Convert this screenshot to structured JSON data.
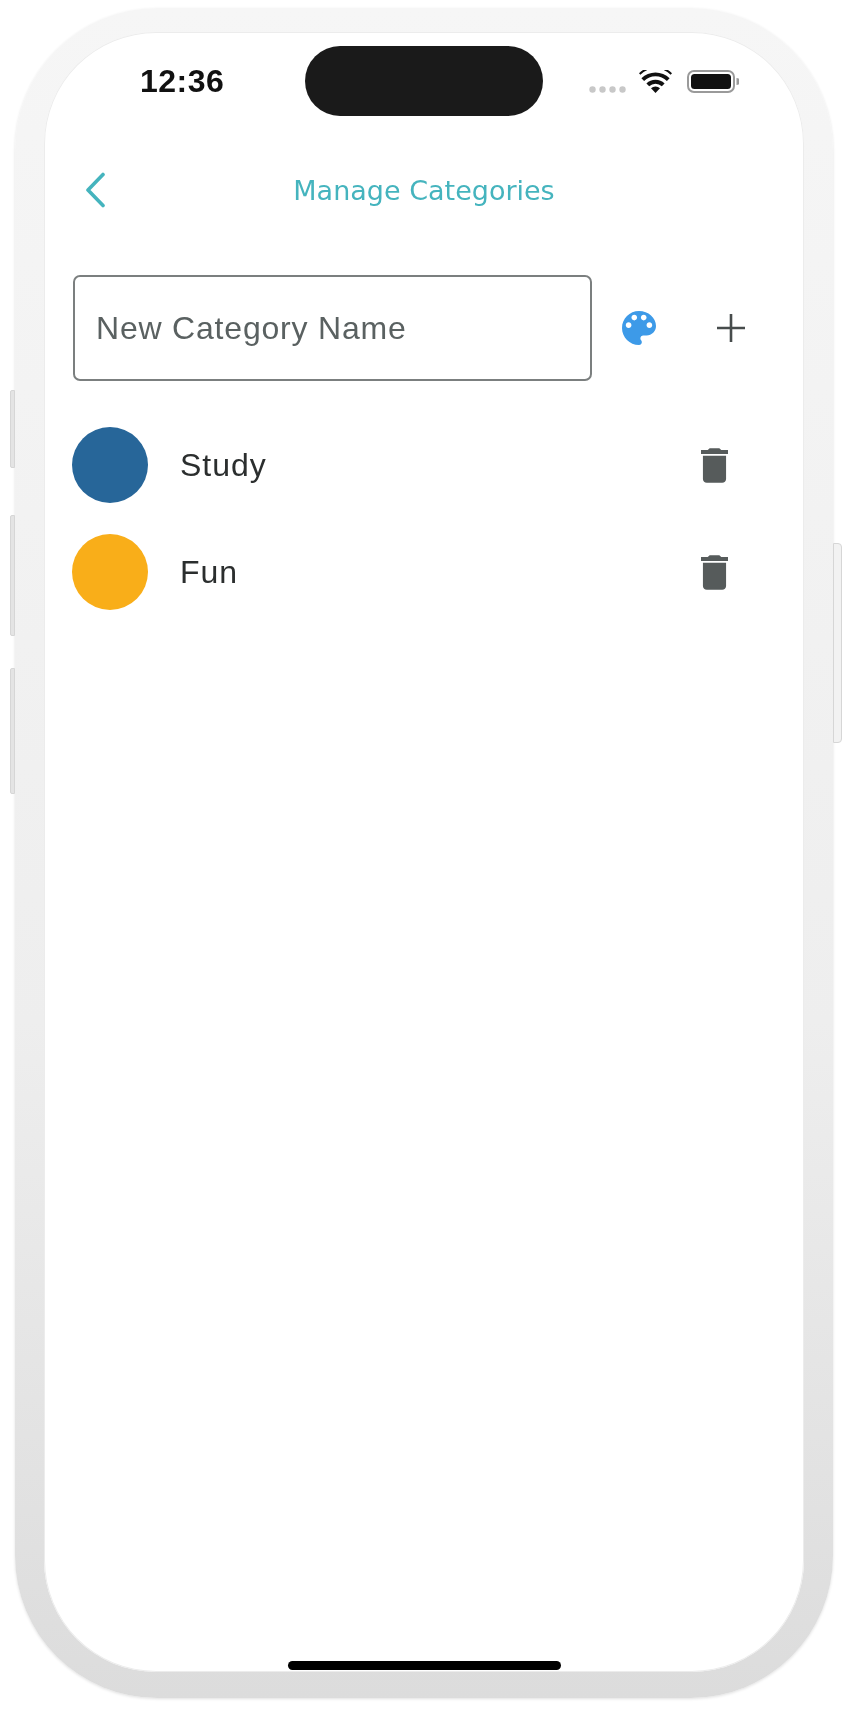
{
  "status_bar": {
    "time": "12:36"
  },
  "header": {
    "title": "Manage Categories"
  },
  "new_category": {
    "placeholder": "New Category Name"
  },
  "categories": [
    {
      "name": "Study",
      "color": "#276699"
    },
    {
      "name": "Fun",
      "color": "#f9ae19"
    }
  ]
}
